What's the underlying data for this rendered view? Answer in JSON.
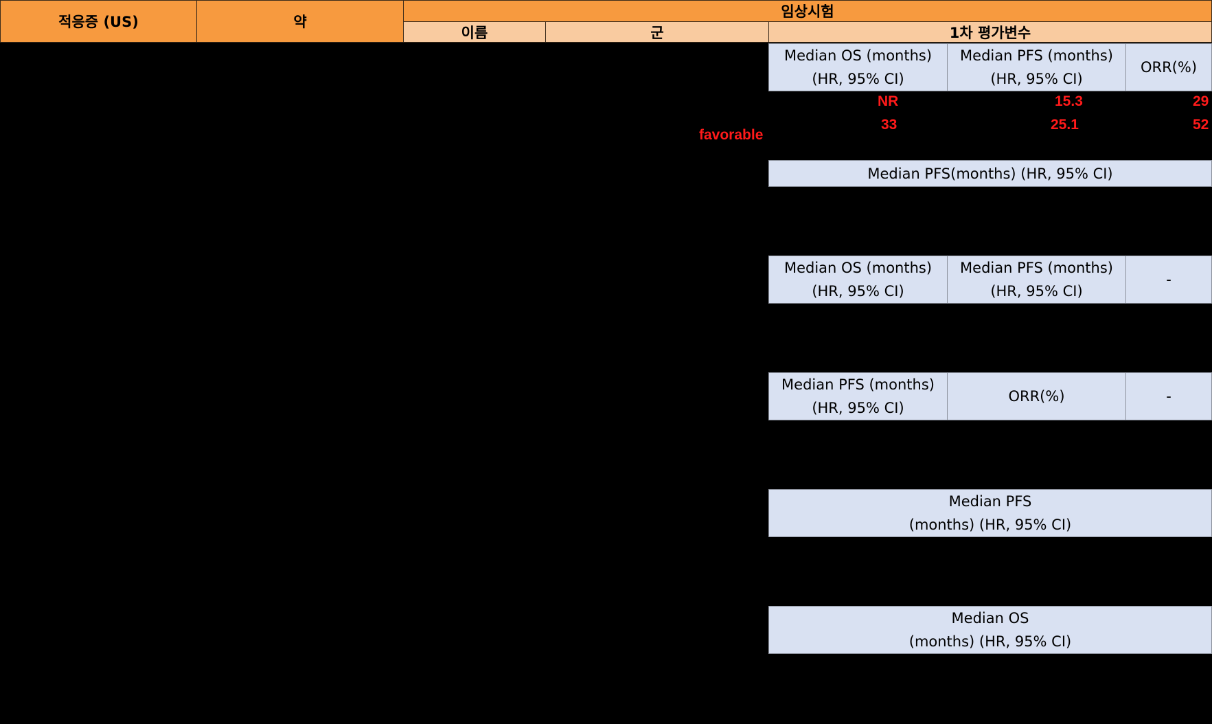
{
  "header": {
    "indication": "적응증 (US)",
    "drug": "약",
    "trial": "임상시험",
    "name": "이름",
    "arm": "군",
    "primary_endpoint": "1차 평가변수"
  },
  "sections": [
    {
      "cells": [
        {
          "line1": "Median OS (months)",
          "line2": "(HR, 95% CI)"
        },
        {
          "line1": "Median PFS (months)",
          "line2": "(HR, 95% CI)"
        },
        {
          "line1": "ORR(%)",
          "line2": ""
        }
      ]
    },
    {
      "cells": [
        {
          "line1": "Median PFS(months) (HR, 95% CI)",
          "line2": ""
        }
      ]
    },
    {
      "cells": [
        {
          "line1": "Median OS (months)",
          "line2": "(HR, 95% CI)"
        },
        {
          "line1": "Median PFS (months)",
          "line2": "(HR, 95% CI)"
        },
        {
          "line1": "-",
          "line2": ""
        }
      ]
    },
    {
      "cells": [
        {
          "line1": "Median PFS (months)",
          "line2": "(HR, 95% CI)"
        },
        {
          "line1": "ORR(%)",
          "line2": ""
        },
        {
          "line1": "-",
          "line2": ""
        }
      ]
    },
    {
      "cells": [
        {
          "line1": "Median PFS",
          "line2": "(months) (HR, 95% CI)"
        }
      ]
    },
    {
      "cells": [
        {
          "line1": "Median OS",
          "line2": "(months) (HR, 95% CI)"
        }
      ]
    }
  ],
  "values": {
    "row1": {
      "os": "NR",
      "pfs": "15.3",
      "orr": "29"
    },
    "row2": {
      "os": "33",
      "pfs": "25.1",
      "orr": "52"
    },
    "favorable": "favorable"
  },
  "colors": {
    "header_dark": "#f79a3f",
    "header_light": "#f9cba0",
    "endpoint_fill": "#d9e1f2",
    "value_text": "#ff1a1a",
    "background": "#000000"
  }
}
